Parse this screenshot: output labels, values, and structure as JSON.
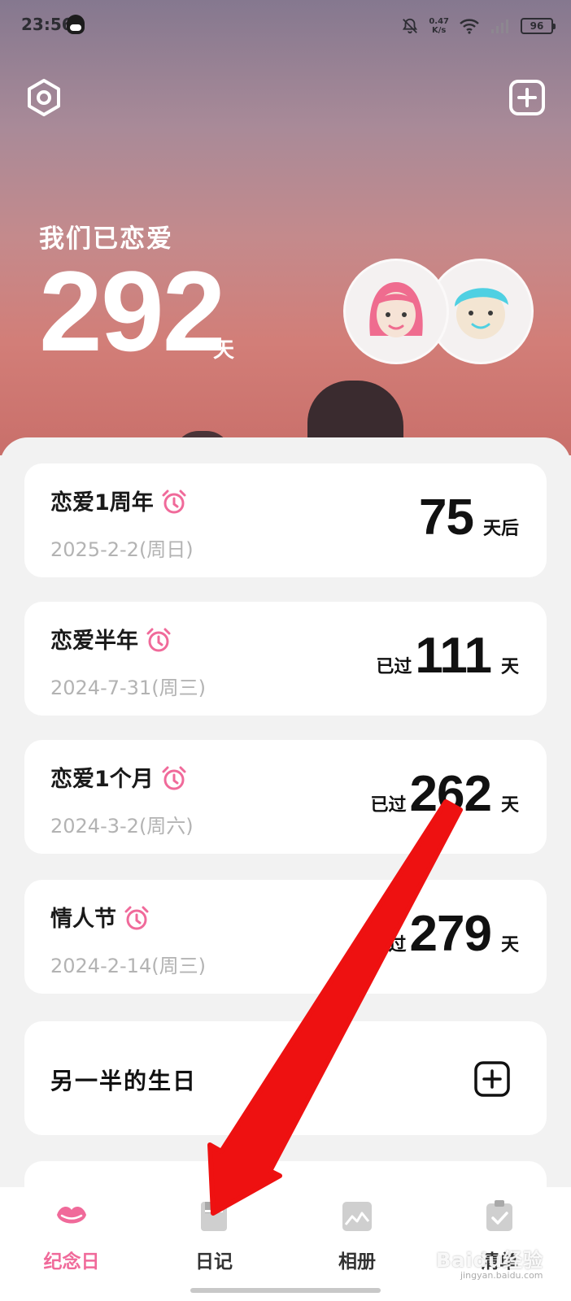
{
  "status_bar": {
    "time": "23:56",
    "net_speed_value": "0.47",
    "net_speed_unit": "K/s",
    "battery": "96"
  },
  "header": {
    "settings_icon": "settings-hexagon-icon",
    "add_icon": "plus-square-icon"
  },
  "hero": {
    "label": "我们已恋爱",
    "days": "292",
    "unit": "天",
    "avatars": [
      "girl-avatar",
      "boy-avatar"
    ]
  },
  "anniversaries": [
    {
      "title": "恋爱1周年",
      "date": "2025-2-2(周日)",
      "prefix": "",
      "count": "75",
      "suffix": "天后"
    },
    {
      "title": "恋爱半年",
      "date": "2024-7-31(周三)",
      "prefix": "已过",
      "count": "111",
      "suffix": "天"
    },
    {
      "title": "恋爱1个月",
      "date": "2024-3-2(周六)",
      "prefix": "已过",
      "count": "262",
      "suffix": "天"
    },
    {
      "title": "情人节",
      "date": "2024-2-14(周三)",
      "prefix": "已过",
      "count": "279",
      "suffix": "天"
    }
  ],
  "birthday": {
    "title": "另一半的生日"
  },
  "tabs": [
    {
      "label": "纪念日",
      "icon": "lips-icon",
      "active": true
    },
    {
      "label": "日记",
      "icon": "diary-icon",
      "active": false
    },
    {
      "label": "相册",
      "icon": "album-icon",
      "active": false
    },
    {
      "label": "清单",
      "icon": "checklist-icon",
      "active": false
    }
  ],
  "watermark": {
    "text": "Baidu经验",
    "sub": "jingyan.baidu.com"
  },
  "colors": {
    "accent_pink": "#f06a9a",
    "annotation_arrow": "#ee1111"
  }
}
